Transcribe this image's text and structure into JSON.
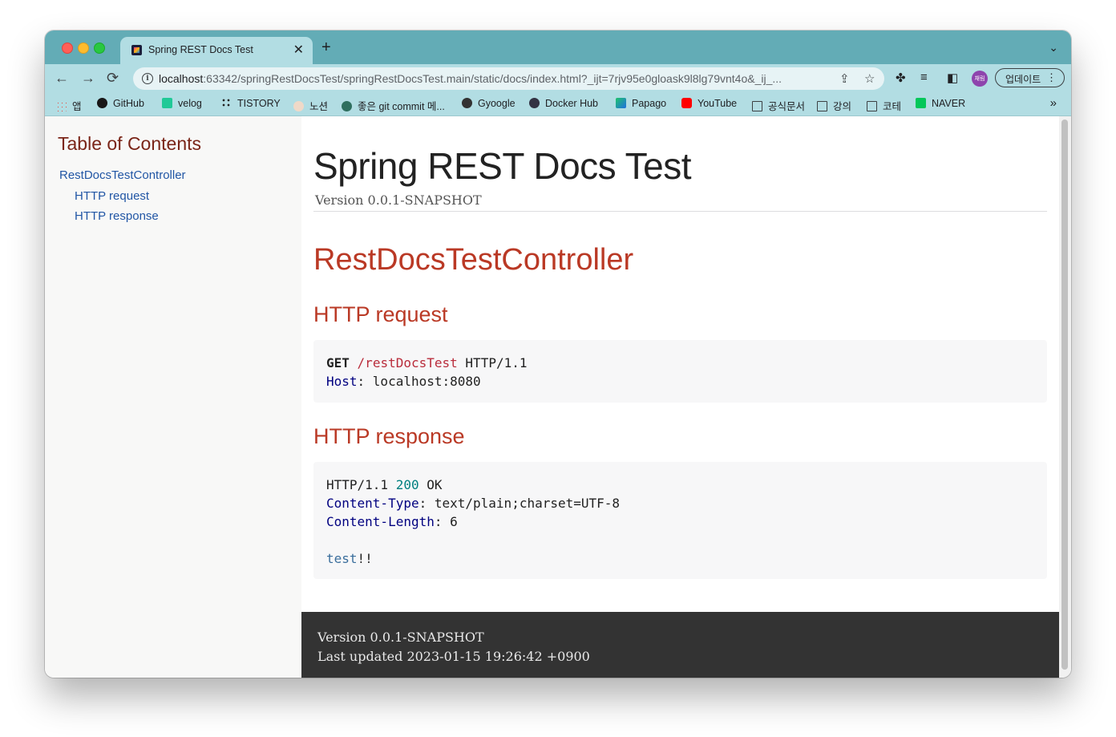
{
  "tab": {
    "title": "Spring REST Docs Test",
    "close": "✕"
  },
  "newtab": "+",
  "tabmenu": "⌄",
  "nav": {
    "back": "←",
    "forward": "→",
    "reload": "⟳"
  },
  "omnibox": {
    "host": "localhost",
    "rest": ":63342/springRestDocsTest/springRestDocsTest.main/static/docs/index.html?_ijt=7rjv95e0gloask9l8lg79vnt4o&_ij_..."
  },
  "profile": "채림",
  "update_label": "업데이트",
  "bookmarks": [
    {
      "label": "앱",
      "icon": "apps-grid-icon"
    },
    {
      "label": "GitHub",
      "icon": "github-icon"
    },
    {
      "label": "velog",
      "icon": "velog-icon"
    },
    {
      "label": "TISTORY",
      "icon": "tistory-icon"
    },
    {
      "label": "노션",
      "icon": "notion-icon"
    },
    {
      "label": "좋은 git commit 메...",
      "icon": "site-icon"
    },
    {
      "label": "Gyoogle",
      "icon": "gyoogle-icon"
    },
    {
      "label": "Docker Hub",
      "icon": "docker-icon"
    },
    {
      "label": "Papago",
      "icon": "papago-icon"
    },
    {
      "label": "YouTube",
      "icon": "youtube-icon"
    },
    {
      "label": "공식문서",
      "icon": "folder-icon"
    },
    {
      "label": "강의",
      "icon": "folder-icon"
    },
    {
      "label": "코테",
      "icon": "folder-icon"
    },
    {
      "label": "NAVER",
      "icon": "naver-icon"
    }
  ],
  "bookmarks_more": "»",
  "toc": {
    "title": "Table of Contents",
    "items": [
      "RestDocsTestController",
      "HTTP request",
      "HTTP response"
    ]
  },
  "doc": {
    "title": "Spring REST Docs Test",
    "version": "Version 0.0.1-SNAPSHOT",
    "section": "RestDocsTestController",
    "request_heading": "HTTP request",
    "request": {
      "method": "GET",
      "path": "/restDocsTest",
      "protocol": "HTTP/1.1",
      "host_name": "Host",
      "host_value": "localhost:8080"
    },
    "response_heading": "HTTP response",
    "response": {
      "protocol": "HTTP/1.1",
      "status": "200",
      "reason": "OK",
      "ct_name": "Content-Type",
      "ct_value": "text/plain;charset=UTF-8",
      "cl_name": "Content-Length",
      "cl_value": "6",
      "body_word": "test",
      "body_rest": "!!"
    }
  },
  "footer": {
    "version": "Version 0.0.1-SNAPSHOT",
    "updated": "Last updated 2023-01-15 19:26:42 +0900"
  }
}
